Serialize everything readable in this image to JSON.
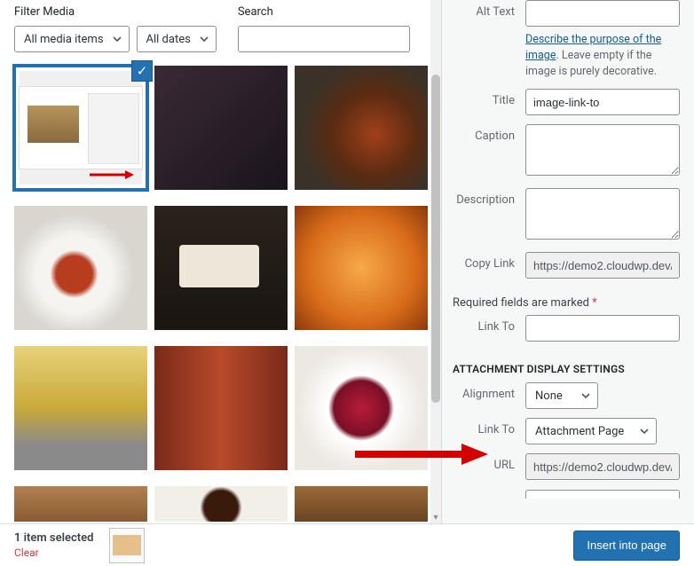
{
  "filter": {
    "label": "Filter Media",
    "media_select": "All media items",
    "date_select": "All dates"
  },
  "search": {
    "label": "Search",
    "value": ""
  },
  "details": {
    "alt_label": "Alt Text",
    "alt_value": "",
    "help_link": "Describe the purpose of the image",
    "help_rest": ". Leave empty if the image is purely decorative.",
    "title_label": "Title",
    "title_value": "image-link-to",
    "caption_label": "Caption",
    "caption_value": "",
    "description_label": "Description",
    "description_value": "",
    "copylink_label": "Copy Link",
    "copylink_value": "https://demo2.cloudwp.dev/...",
    "required_text": "Required fields are marked ",
    "linkto_label": "Link To",
    "linkto_value": ""
  },
  "display": {
    "header": "ATTACHMENT DISPLAY SETTINGS",
    "align_label": "Alignment",
    "align_value": "None",
    "linkto_label": "Link To",
    "linkto_value": "Attachment Page",
    "url_label": "URL",
    "url_value": "https://demo2.cloudwp.dev/..."
  },
  "footer": {
    "selected": "1 item selected",
    "clear": "Clear",
    "insert": "Insert into page"
  }
}
